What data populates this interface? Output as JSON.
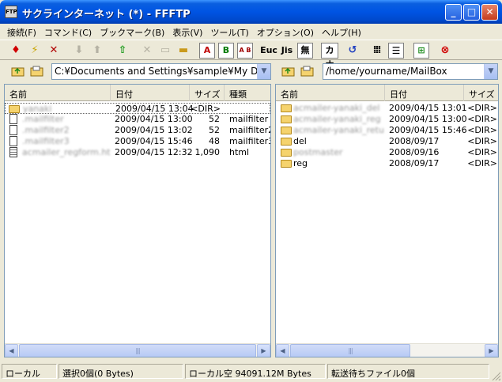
{
  "window": {
    "title": "サクラインターネット (*) - FFFTP",
    "app_icon_label": "FTP",
    "minimize": "_",
    "maximize": "□",
    "close": "✕"
  },
  "menu": [
    "接続(F)",
    "コマンド(C)",
    "ブックマーク(B)",
    "表示(V)",
    "ツール(T)",
    "オプション(O)",
    "ヘルプ(H)"
  ],
  "toolbar": {
    "connect_icon": "plug-icon",
    "quick_connect_icon": "lightning-icon",
    "disconnect_icon": "disconnect-icon",
    "ascii_label": "A",
    "binary_label": "B",
    "auto_label": "A B",
    "euc_label": "Euc",
    "jis_label": "Jis",
    "nokanji_label": "無",
    "kana_label": "カナ"
  },
  "local": {
    "path": "C:¥Documents and Settings¥sample¥My Documents",
    "columns": [
      "名前",
      "日付",
      "サイズ",
      "種類"
    ],
    "files": [
      {
        "name": "yanaki",
        "date": "2009/04/15 13:04",
        "size": "<DIR>",
        "type": "",
        "kind": "folder",
        "blur": true,
        "selected": true
      },
      {
        "name": ".mailfilter",
        "date": "2009/04/15 13:00",
        "size": "52",
        "type": "mailfilter",
        "kind": "file",
        "blur": true
      },
      {
        "name": ".mailfilter2",
        "date": "2009/04/15 13:02",
        "size": "52",
        "type": "mailfilter2",
        "kind": "file",
        "blur": true
      },
      {
        "name": ".mailfilter3",
        "date": "2009/04/15 15:46",
        "size": "48",
        "type": "mailfilter3",
        "kind": "file",
        "blur": true
      },
      {
        "name": "acmailer_regform.html",
        "date": "2009/04/15 12:32",
        "size": "1,090",
        "type": "html",
        "kind": "html",
        "blur": true
      }
    ]
  },
  "remote": {
    "path": "/home/yourname/MailBox",
    "columns": [
      "名前",
      "日付",
      "サイズ"
    ],
    "files": [
      {
        "name": "acmailer-yanaki_del",
        "date": "2009/04/15 13:01",
        "size": "<DIR>",
        "blur": true
      },
      {
        "name": "acmailer-yanaki_reg",
        "date": "2009/04/15 13:00",
        "size": "<DIR>",
        "blur": true
      },
      {
        "name": "acmailer-yanaki_return",
        "date": "2009/04/15 15:46",
        "size": "<DIR>",
        "blur": true
      },
      {
        "name": "del",
        "date": "2008/09/17",
        "size": "<DIR>",
        "blur": false
      },
      {
        "name": "postmaster",
        "date": "2008/09/16",
        "size": "<DIR>",
        "blur": true
      },
      {
        "name": "reg",
        "date": "2008/09/17",
        "size": "<DIR>",
        "blur": false
      }
    ]
  },
  "status": {
    "location": "ローカル",
    "selection": "選択0個(0 Bytes)",
    "free_space": "ローカル空 94091.12M Bytes",
    "queue": "転送待ちファイル0個"
  },
  "scroll": {
    "left_arrow": "◀",
    "right_arrow": "▶",
    "thumb_grip": "|||"
  }
}
